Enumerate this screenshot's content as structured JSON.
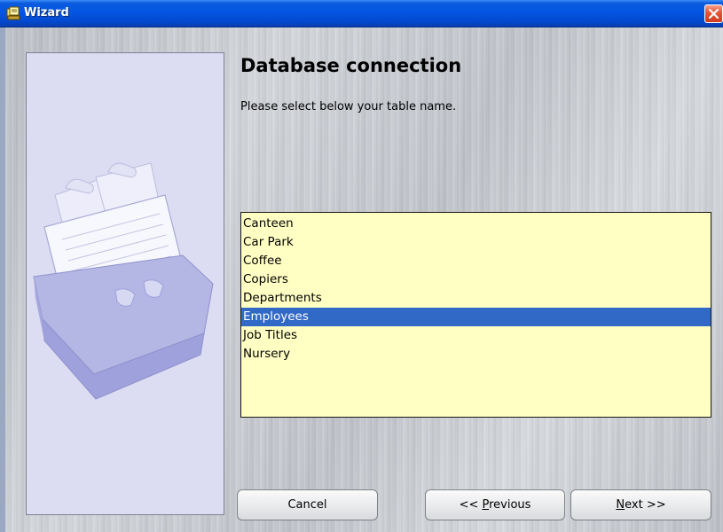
{
  "window": {
    "title": "Wizard"
  },
  "page": {
    "heading": "Database connection",
    "instruction": "Please select below your table name."
  },
  "tables": {
    "items": [
      "Canteen",
      "Car Park",
      "Coffee",
      "Copiers",
      "Departments",
      "Employees",
      "Job Titles",
      "Nursery"
    ],
    "selected": "Employees"
  },
  "buttons": {
    "cancel": "Cancel",
    "previous_prefix": "<< ",
    "previous_mnemonic": "P",
    "previous_rest": "revious",
    "next_mnemonic": "N",
    "next_rest": "ext >>"
  },
  "colors": {
    "titlebar": "#0456e2",
    "listbox_bg": "#ffffc4",
    "selection": "#3169c6",
    "close_button": "#e8563a"
  },
  "icons": {
    "app": "card-file-icon",
    "close": "close-icon",
    "illustration": "rolodex-card-file-illustration"
  }
}
